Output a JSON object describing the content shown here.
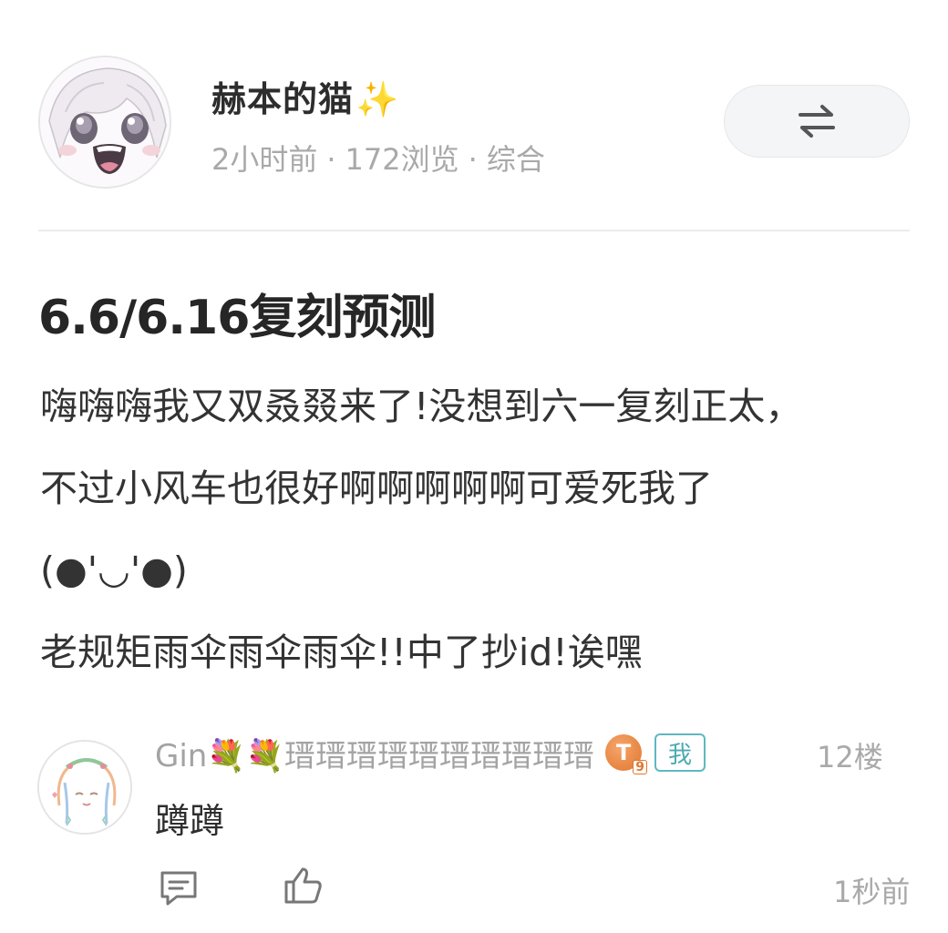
{
  "post": {
    "author_name": "赫本的猫",
    "author_sparkle": "✨",
    "time": "2小时前",
    "views": "172浏览",
    "category": "综合",
    "meta_separator": "·",
    "title": "6.6/6.16复刻预测",
    "body_lines": [
      "嗨嗨嗨我又双叒叕来了!没想到六一复刻正太，",
      "不过小风车也很好啊啊啊啊啊可爱死我了",
      "(●'◡'●)",
      "老规矩雨伞雨伞雨伞!!中了抄id!诶嘿"
    ]
  },
  "header": {
    "switch_icon": "swap-arrows-icon"
  },
  "comment": {
    "username": "Gin💐💐瑨瑨瑨瑨瑨瑨瑨瑨瑨瑨",
    "level_letter": "T",
    "level_number": "9",
    "me_badge": "我",
    "floor": "12楼",
    "text": "蹲蹲",
    "time": "1秒前",
    "reply_icon": "reply-bubble-icon",
    "like_icon": "thumbs-up-icon"
  },
  "colors": {
    "accent_teal": "#4eaab3",
    "meta_gray": "#a9a9a9",
    "sparkle": "#f3c23c"
  }
}
